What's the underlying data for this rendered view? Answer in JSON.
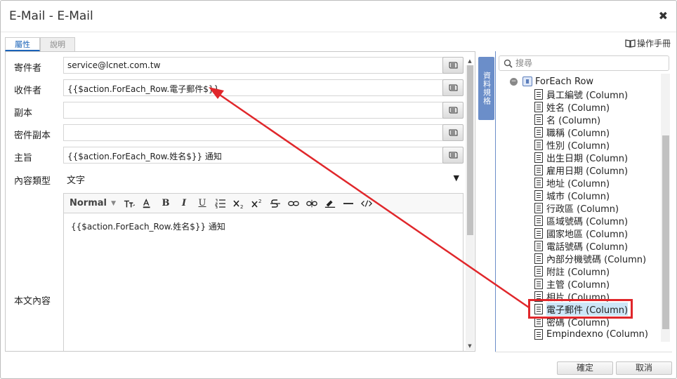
{
  "dialog": {
    "title": "E-Mail - E-Mail",
    "close_label": "✖"
  },
  "tabs": [
    {
      "label": "屬性",
      "active": true
    },
    {
      "label": "說明",
      "active": false
    }
  ],
  "manual_label": "操作手冊",
  "form": {
    "sender": {
      "label": "寄件者",
      "value": "service@lcnet.com.tw"
    },
    "recipient": {
      "label": "收件者",
      "value": "{{$action.ForEach_Row.電子郵件$}}"
    },
    "cc": {
      "label": "副本",
      "value": ""
    },
    "bcc": {
      "label": "密件副本",
      "value": ""
    },
    "subject": {
      "label": "主旨",
      "value": "{{$action.ForEach_Row.姓名$}} 通知"
    },
    "content_type": {
      "label": "內容類型",
      "value": "文字"
    },
    "body": {
      "label": "本文內容",
      "value": "{{$action.ForEach_Row.姓名$}} 通知"
    }
  },
  "editor_toolbar": {
    "format": "Normal",
    "bold": "B",
    "italic": "I",
    "underline": "U"
  },
  "data_spec_tab": "資料規格",
  "search": {
    "placeholder": "搜尋"
  },
  "tree": {
    "parent": "ForEach Row",
    "columns": [
      "員工編號 (Column)",
      "姓名 (Column)",
      "名 (Column)",
      "職稱 (Column)",
      "性別 (Column)",
      "出生日期 (Column)",
      "雇用日期 (Column)",
      "地址 (Column)",
      "城市 (Column)",
      "行政區 (Column)",
      "區域號碼 (Column)",
      "國家地區 (Column)",
      "電話號碼 (Column)",
      "內部分機號碼 (Column)",
      "附註 (Column)",
      "主管 (Column)",
      "相片 (Column)",
      "電子郵件 (Column)",
      "密碼 (Column)",
      "Empindexno (Column)"
    ],
    "selected": "電子郵件 (Column)"
  },
  "footer": {
    "ok": "確定",
    "cancel": "取消"
  },
  "colors": {
    "accent": "#1a63b8",
    "spec_tab": "#6b8ec9",
    "annotation": "#e0272b",
    "selected_bg": "#cde6f7"
  }
}
